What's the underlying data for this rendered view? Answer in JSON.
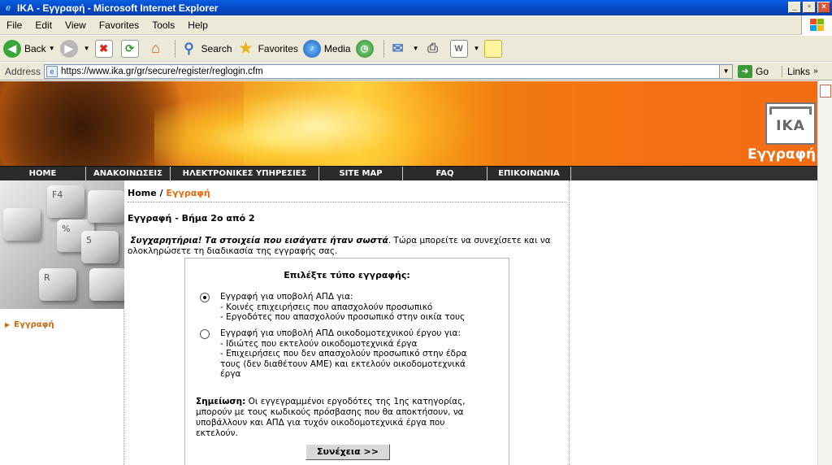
{
  "window": {
    "title": "ΙΚΑ - Εγγραφή - Microsoft Internet Explorer",
    "minimize": "_",
    "maximize": "▫",
    "close": "×"
  },
  "menu": [
    "File",
    "Edit",
    "View",
    "Favorites",
    "Tools",
    "Help"
  ],
  "toolbar": {
    "back": "Back",
    "search": "Search",
    "favorites": "Favorites",
    "media": "Media"
  },
  "address": {
    "label": "Address",
    "url": "https://www.ika.gr/gr/secure/register/reglogin.cfm",
    "go": "Go",
    "links": "Links"
  },
  "banner": {
    "logo_text": "IKA",
    "title": "Εγγραφή"
  },
  "nav": [
    "HOME",
    "ΑΝΑΚΟΙΝΩΣΕΙΣ",
    "ΗΛΕΚΤΡΟΝΙΚΕΣ ΥΠΗΡΕΣΙΕΣ",
    "SITE MAP",
    "FAQ",
    "ΕΠΙΚΟΙΝΩΝΙΑ"
  ],
  "keyboard_keys": [
    "F4",
    "%",
    "5",
    "R"
  ],
  "sidebar": {
    "link": "Εγγραφή"
  },
  "breadcrumb": {
    "home": "Home",
    "sep": " / ",
    "current": "Εγγραφή"
  },
  "main": {
    "step_title": "Εγγραφή - Βήμα 2ο από 2",
    "congrats_bold": "Συγχαρητήρια! Τα στοιχεία που εισάγατε ήταν σωστά",
    "congrats_rest": ". Τώρα μπορείτε να συνεχίσετε και να ολοκληρώσετε τη διαδικασία της εγγραφής σας.",
    "choose_title": "Επιλέξτε τύπο εγγραφής:",
    "option1": {
      "heading": "Εγγραφή για υποβολή ΑΠΔ για:",
      "line1": "- Κοινές επιχειρήσεις που απασχολούν προσωπικό",
      "line2": "- Εργοδότες που απασχολούν προσωπικό στην οικία τους",
      "selected": true
    },
    "option2": {
      "heading": "Εγγραφή για υποβολή ΑΠΔ οικοδομοτεχνικού έργου για:",
      "line1": "- Ιδιώτες που εκτελούν οικοδομοτεχνικά έργα",
      "line2": "- Επιχειρήσεις που δεν απασχολούν προσωπικό στην έδρα τους (δεν διαθέτουν ΑΜΕ) και εκτελούν οικοδομοτεχνικά έργα",
      "selected": false
    },
    "note_label": "Σημείωση:",
    "note_text": " Οι εγγεγραμμένοι εργοδότες της 1ης κατηγορίας, μπορούν με τους κωδικούς πρόσβασης που θα αποκτήσουν, να υποβάλλουν και ΑΠΔ για τυχόν οικοδομοτεχνικά έργα που εκτελούν.",
    "continue": "Συνέχεια >>"
  }
}
